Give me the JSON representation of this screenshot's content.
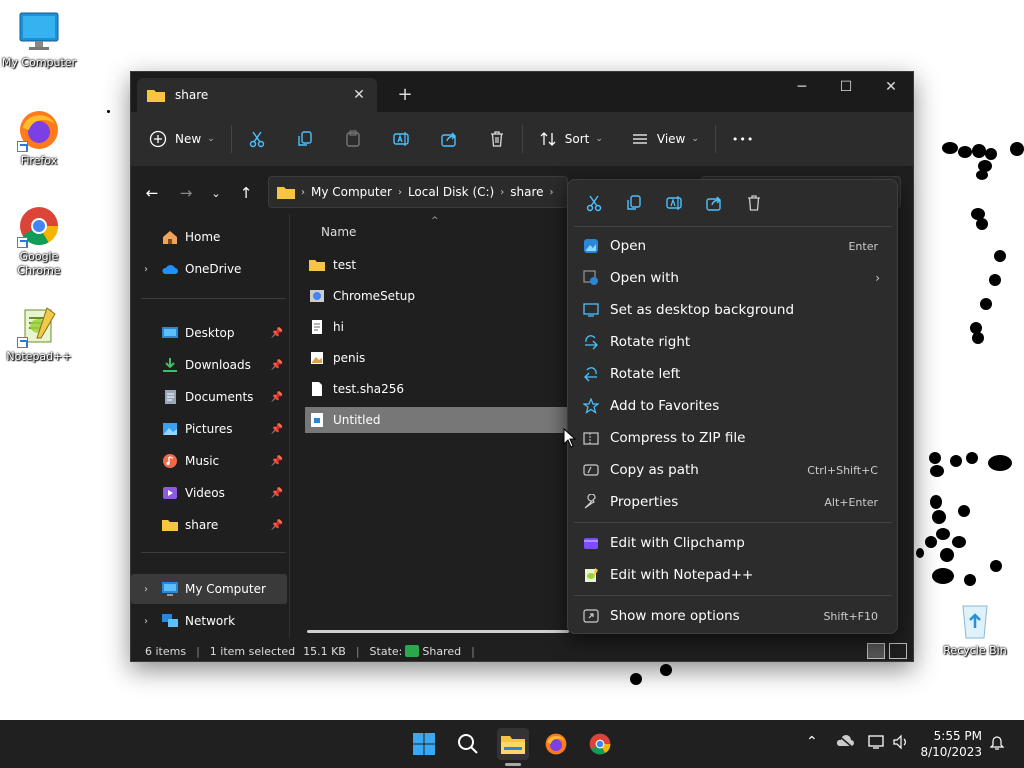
{
  "desktop": {
    "icons": [
      {
        "label": "My Computer",
        "icon": "monitor-icon"
      },
      {
        "label": "Firefox",
        "icon": "firefox-icon"
      },
      {
        "label": "Google Chrome",
        "icon": "chrome-icon"
      },
      {
        "label": "Notepad++",
        "icon": "notepadpp-icon"
      }
    ],
    "recycle_bin": "Recycle Bin"
  },
  "window": {
    "tab_title": "share",
    "new_tab": "+",
    "controls": {
      "minimize": "─",
      "maximize": "☐",
      "close": "✕"
    }
  },
  "toolbar": {
    "new_label": "New",
    "sort_label": "Sort",
    "view_label": "View",
    "more_label": "•••"
  },
  "address": {
    "crumbs": [
      "My Computer",
      "Local Disk (C:)",
      "share"
    ]
  },
  "nav": {
    "items": [
      {
        "label": "Home",
        "icon": "home-icon"
      },
      {
        "label": "OneDrive",
        "icon": "cloud-icon"
      },
      {
        "label": "Desktop",
        "icon": "desktop-icon"
      },
      {
        "label": "Downloads",
        "icon": "download-icon"
      },
      {
        "label": "Documents",
        "icon": "documents-icon"
      },
      {
        "label": "Pictures",
        "icon": "pictures-icon"
      },
      {
        "label": "Music",
        "icon": "music-icon"
      },
      {
        "label": "Videos",
        "icon": "videos-icon"
      },
      {
        "label": "share",
        "icon": "folder-icon"
      },
      {
        "label": "My Computer",
        "icon": "computer-icon"
      },
      {
        "label": "Network",
        "icon": "network-icon"
      }
    ]
  },
  "files": {
    "column_name": "Name",
    "rows": [
      {
        "name": "test",
        "icon": "folder-icon"
      },
      {
        "name": "ChromeSetup",
        "icon": "installer-icon"
      },
      {
        "name": "hi",
        "icon": "text-file-icon"
      },
      {
        "name": "penis",
        "icon": "image-file-icon"
      },
      {
        "name": "test.sha256",
        "icon": "file-icon"
      },
      {
        "name": "Untitled",
        "icon": "image-file-icon"
      }
    ]
  },
  "status": {
    "count": "6 items",
    "selected": "1 item selected",
    "size": "15.1 KB",
    "state_label": "State:",
    "state_value": "Shared"
  },
  "context_menu": {
    "items": [
      {
        "label": "Open",
        "shortcut": "Enter"
      },
      {
        "label": "Open with",
        "shortcut": ""
      },
      {
        "label": "Set as desktop background",
        "shortcut": ""
      },
      {
        "label": "Rotate right",
        "shortcut": ""
      },
      {
        "label": "Rotate left",
        "shortcut": ""
      },
      {
        "label": "Add to Favorites",
        "shortcut": ""
      },
      {
        "label": "Compress to ZIP file",
        "shortcut": ""
      },
      {
        "label": "Copy as path",
        "shortcut": "Ctrl+Shift+C"
      },
      {
        "label": "Properties",
        "shortcut": "Alt+Enter"
      },
      {
        "label": "Edit with Clipchamp",
        "shortcut": ""
      },
      {
        "label": "Edit with Notepad++",
        "shortcut": ""
      },
      {
        "label": "Show more options",
        "shortcut": "Shift+F10"
      }
    ]
  },
  "taskbar": {
    "time": "5:55 PM",
    "date": "8/10/2023"
  },
  "colors": {
    "accent": "#4cc2ff",
    "folder": "#f8c542",
    "explorer_bg": "#1f1f1f",
    "menu_bg": "#2c2c2c"
  }
}
